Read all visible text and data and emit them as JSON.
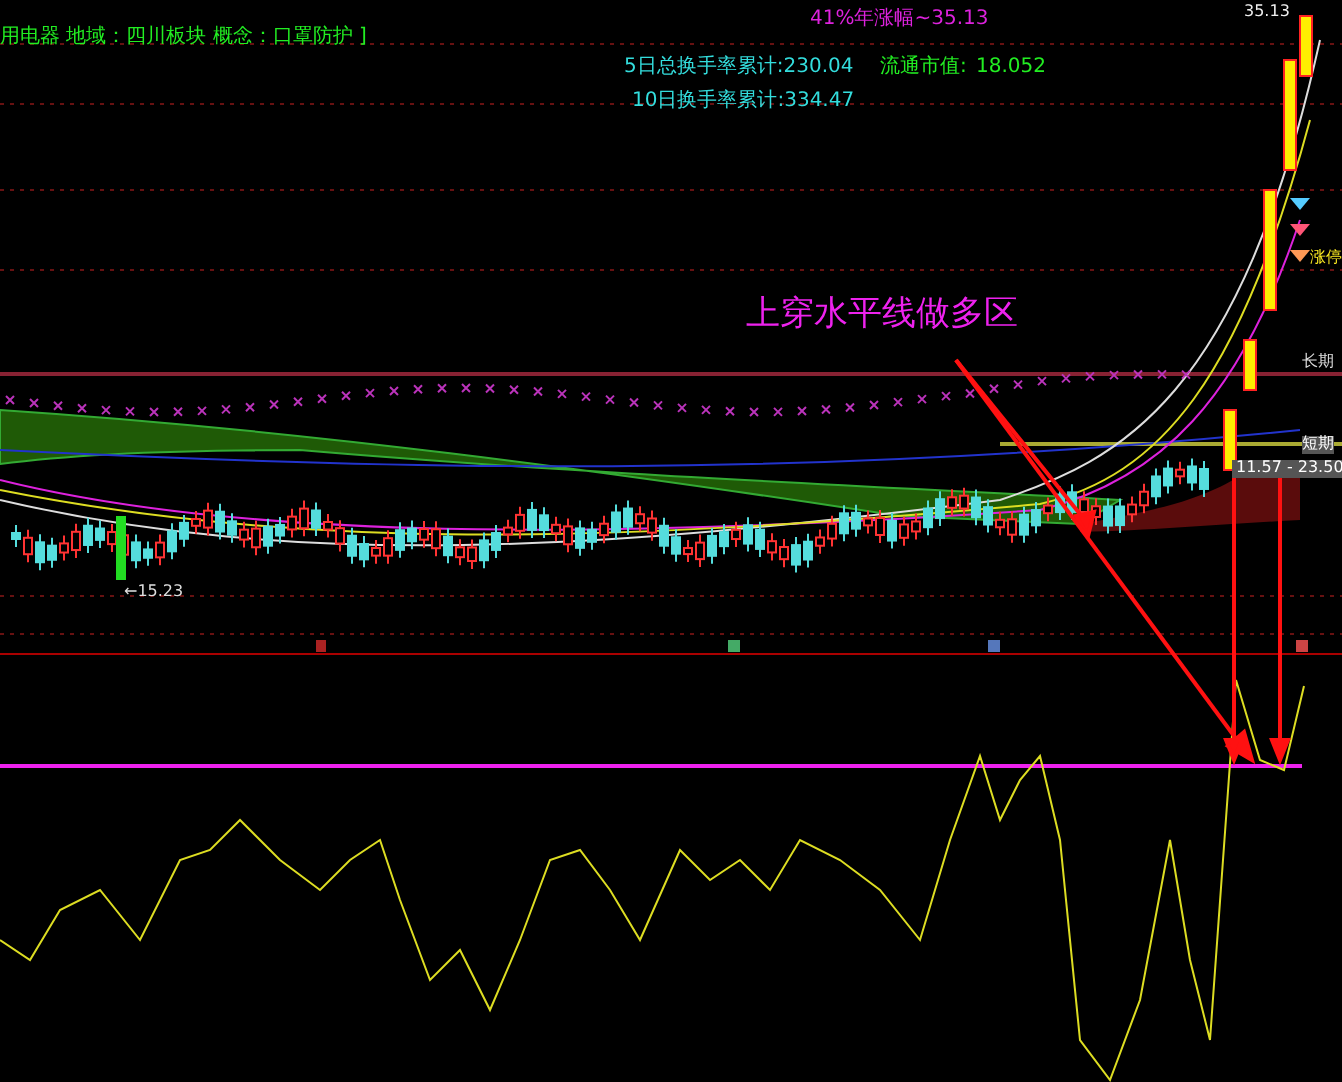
{
  "header": {
    "sector_info": "用电器 地域：四川板块 概念：口罩防护 ]",
    "yearly_gain": "41%年涨幅~35.13",
    "turnover_5d": "5日总换手率累计:230.04",
    "turnover_10d": "10日换手率累计:334.47",
    "float_cap_label": "流通市值:",
    "float_cap_value": "18.052"
  },
  "price_chart": {
    "high_label": "35.13",
    "limit_up_tag": "涨停",
    "long_term_line_label": "长期",
    "short_term_line_label": "短期",
    "range_label": "11.57 - 23.50",
    "low_label": "←15.23",
    "annotation": "上穿水平线做多区"
  }
}
